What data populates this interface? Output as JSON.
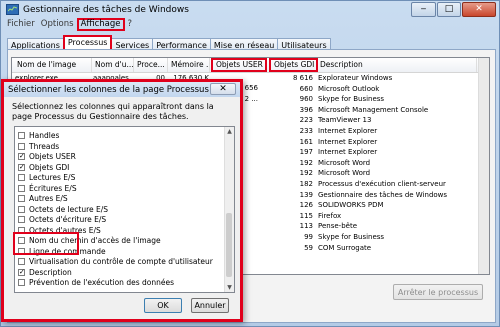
{
  "window": {
    "title": "Gestionnaire des tâches de Windows",
    "minimize": "‒",
    "maximize": "□",
    "close": "✕"
  },
  "menu": [
    "Fichier",
    "Options",
    "Affichage",
    "?"
  ],
  "tabs": [
    "Applications",
    "Processus",
    "Services",
    "Performance",
    "Mise en réseau",
    "Utilisateurs"
  ],
  "process_table": {
    "headers": [
      "Nom de l'image",
      "Nom d'u...",
      "Proce...",
      "Mémoire ...",
      "Objets USER",
      "Objets GDI",
      "Description"
    ],
    "rows": [
      {
        "name": "explorer.exe",
        "user": "aaanoales",
        "cpu": "00",
        "mem": "176 630 K",
        "user_obj": "",
        "gdi": "8 616",
        "desc": "Explorateur Windows"
      },
      {
        "gdi": "660",
        "desc": "Microsoft Outlook"
      },
      {
        "gdi": "960",
        "desc": "Skype for Business"
      },
      {
        "gdi": "396",
        "desc": "Microsoft Management Console"
      },
      {
        "gdi": "223",
        "desc": "TeamViewer 13"
      },
      {
        "gdi": "233",
        "desc": "Internet Explorer"
      },
      {
        "gdi": "161",
        "desc": "Internet Explorer"
      },
      {
        "gdi": "197",
        "desc": "Internet Explorer"
      },
      {
        "gdi": "192",
        "desc": "Microsoft Word"
      },
      {
        "gdi": "192",
        "desc": "Microsoft Word"
      },
      {
        "gdi": "182",
        "desc": "Processus d'exécution client-serveur"
      },
      {
        "gdi": "139",
        "desc": "Gestionnaire des tâches de Windows"
      },
      {
        "gdi": "126",
        "desc": "SOLIDWORKS PDM"
      },
      {
        "gdi": "115",
        "desc": "Firefox"
      },
      {
        "gdi": "113",
        "desc": "Pense-bête"
      },
      {
        "gdi": "99",
        "desc": "Skype for Business"
      },
      {
        "gdi": "59",
        "desc": "COM Surrogate"
      }
    ],
    "partial_values": [
      "2 656",
      "2 ..."
    ]
  },
  "end_process_button": "Arrêter le processus",
  "dialog": {
    "title": "Sélectionner les colonnes de la page Processus",
    "close": "✕",
    "description": "Sélectionnez les colonnes qui apparaîtront dans la page Processus du Gestionnaire des tâches.",
    "columns": [
      {
        "label": "Handles",
        "checked": false
      },
      {
        "label": "Threads",
        "checked": false
      },
      {
        "label": "Objets USER",
        "checked": true
      },
      {
        "label": "Objets GDI",
        "checked": true
      },
      {
        "label": "Lectures E/S",
        "checked": false
      },
      {
        "label": "Écritures E/S",
        "checked": false
      },
      {
        "label": "Autres E/S",
        "checked": false
      },
      {
        "label": "Octets de lecture E/S",
        "checked": false
      },
      {
        "label": "Octets d'écriture E/S",
        "checked": false
      },
      {
        "label": "Octets d'autres E/S",
        "checked": false
      },
      {
        "label": "Nom du chemin d'accès de l'image",
        "checked": false
      },
      {
        "label": "Ligne de commande",
        "checked": false
      },
      {
        "label": "Virtualisation du contrôle de compte d'utilisateur",
        "checked": false
      },
      {
        "label": "Description",
        "checked": true
      },
      {
        "label": "Prévention de l'exécution des données",
        "checked": false
      }
    ],
    "ok": "OK",
    "cancel": "Annuler"
  },
  "colors": {
    "highlight": "#e0001b",
    "title_bar": "#c9dcf0"
  }
}
